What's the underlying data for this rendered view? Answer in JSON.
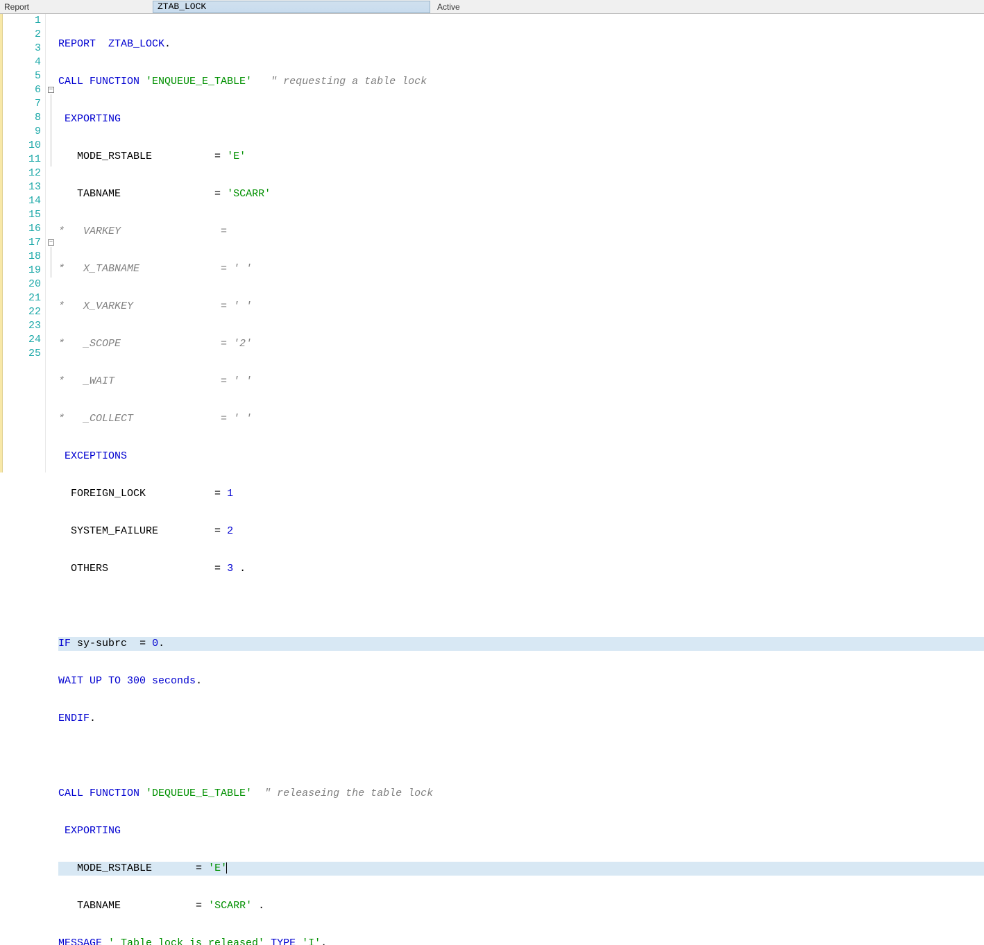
{
  "header": {
    "label": "Report",
    "field_value": "ZTAB_LOCK",
    "status": "Active"
  },
  "gutter": {
    "lines": [
      "1",
      "2",
      "3",
      "4",
      "5",
      "6",
      "7",
      "8",
      "9",
      "10",
      "11",
      "12",
      "13",
      "14",
      "15",
      "16",
      "17",
      "18",
      "19",
      "20",
      "21",
      "22",
      "23",
      "24",
      "25"
    ]
  },
  "code": {
    "l1": {
      "a": "REPORT  ZTAB_LOCK",
      "b": "."
    },
    "l2": {
      "a": "CALL FUNCTION ",
      "b": "'ENQUEUE_E_TABLE'",
      "c": "   \" requesting a table lock"
    },
    "l3": {
      "a": " EXPORTING"
    },
    "l4": {
      "a": "   MODE_RSTABLE          ",
      "b": "=",
      "c": " 'E'"
    },
    "l5": {
      "a": "   TABNAME               ",
      "b": "=",
      "c": " 'SCARR'"
    },
    "l6": {
      "a": "*   VARKEY                = "
    },
    "l7": {
      "a": "*   X_TABNAME             = ' '"
    },
    "l8": {
      "a": "*   X_VARKEY              = ' '"
    },
    "l9": {
      "a": "*   _SCOPE                = '2'"
    },
    "l10": {
      "a": "*   _WAIT                 = ' '"
    },
    "l11": {
      "a": "*   _COLLECT              = ' '"
    },
    "l12": {
      "a": " EXCEPTIONS"
    },
    "l13": {
      "a": "  FOREIGN_LOCK           ",
      "b": "=",
      "c": " 1"
    },
    "l14": {
      "a": "  SYSTEM_FAILURE         ",
      "b": "=",
      "c": " 2"
    },
    "l15": {
      "a": "  OTHERS                 ",
      "b": "=",
      "c": " 3 ",
      "d": "."
    },
    "l17": {
      "a": "IF ",
      "b": "sy",
      "c": "-",
      "d": "subrc  ",
      "e": "=",
      "f": " 0",
      "g": "."
    },
    "l18": {
      "a": "WAIT UP TO ",
      "b": "300 ",
      "c": "seconds",
      "d": "."
    },
    "l19": {
      "a": "ENDIF",
      "b": "."
    },
    "l21": {
      "a": "CALL FUNCTION ",
      "b": "'DEQUEUE_E_TABLE'",
      "c": "  \" releaseing the table lock"
    },
    "l22": {
      "a": " EXPORTING"
    },
    "l23": {
      "a": "   MODE_RSTABLE       ",
      "b": "=",
      "c": " 'E'"
    },
    "l24": {
      "a": "   TABNAME            ",
      "b": "=",
      "c": " 'SCARR' ",
      "d": "."
    },
    "l25": {
      "a": "MESSAGE ",
      "b": "' Table lock is released' ",
      "c": "TYPE ",
      "d": "'I'",
      "e": "."
    }
  }
}
